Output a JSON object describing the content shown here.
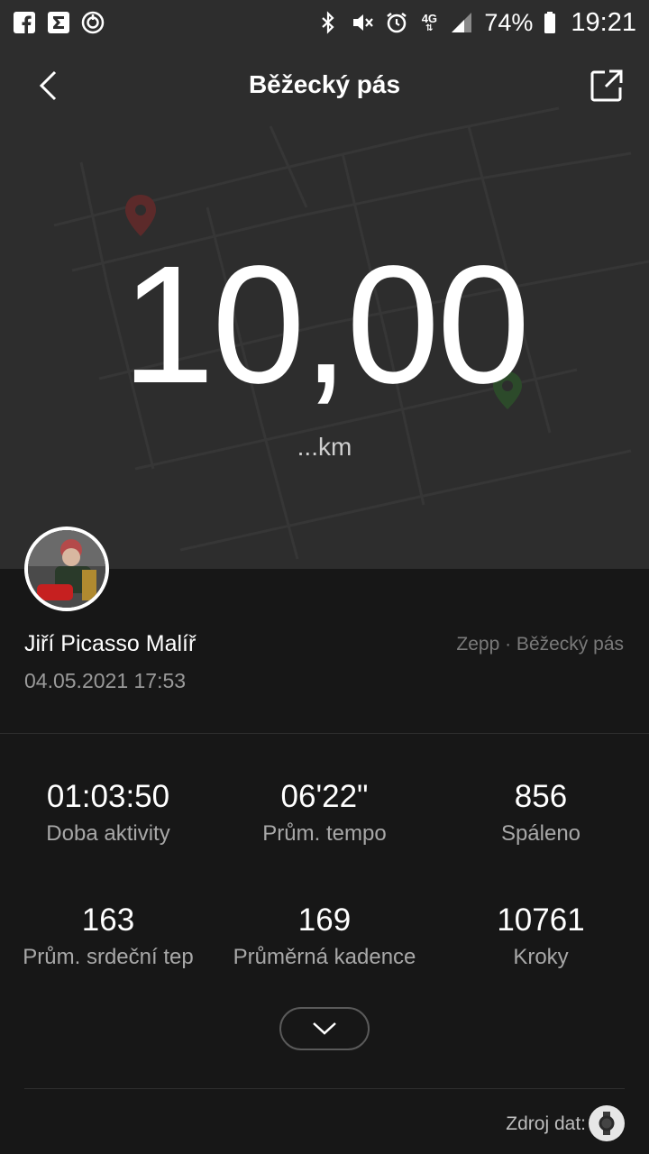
{
  "status_bar": {
    "left_icons": [
      "facebook-icon",
      "sigma-icon",
      "power-ring-icon"
    ],
    "right_icons": [
      "bluetooth-icon",
      "muted-icon",
      "alarm-icon",
      "network-4g-icon",
      "signal-icon",
      "battery-icon"
    ],
    "network": "4G",
    "battery": "74%",
    "time": "19:21"
  },
  "header": {
    "title": "Běžecký pás",
    "back_icon": "chevron-left-icon",
    "share_icon": "share-icon"
  },
  "hero": {
    "distance": "10,00",
    "unit": "...km"
  },
  "profile": {
    "name": "Jiří Picasso Malíř",
    "date": "04.05.2021 17:53",
    "source": "Zepp · Běžecký pás"
  },
  "stats": [
    {
      "value": "01:03:50",
      "label": "Doba aktivity"
    },
    {
      "value": "06'22\"",
      "label": "Prům. tempo"
    },
    {
      "value": "856",
      "label": "Spáleno"
    },
    {
      "value": "163",
      "label": "Prům. srdeční tep"
    },
    {
      "value": "169",
      "label": "Průměrná kadence"
    },
    {
      "value": "10761",
      "label": "Kroky"
    }
  ],
  "footer": {
    "data_source_label": "Zdroj dat:",
    "device_icon": "watch-icon"
  },
  "colors": {
    "hero_bg": "#2d2d2d",
    "body_bg": "#171717",
    "start_pin": "#b23a3a",
    "end_pin": "#3f7d3a"
  }
}
